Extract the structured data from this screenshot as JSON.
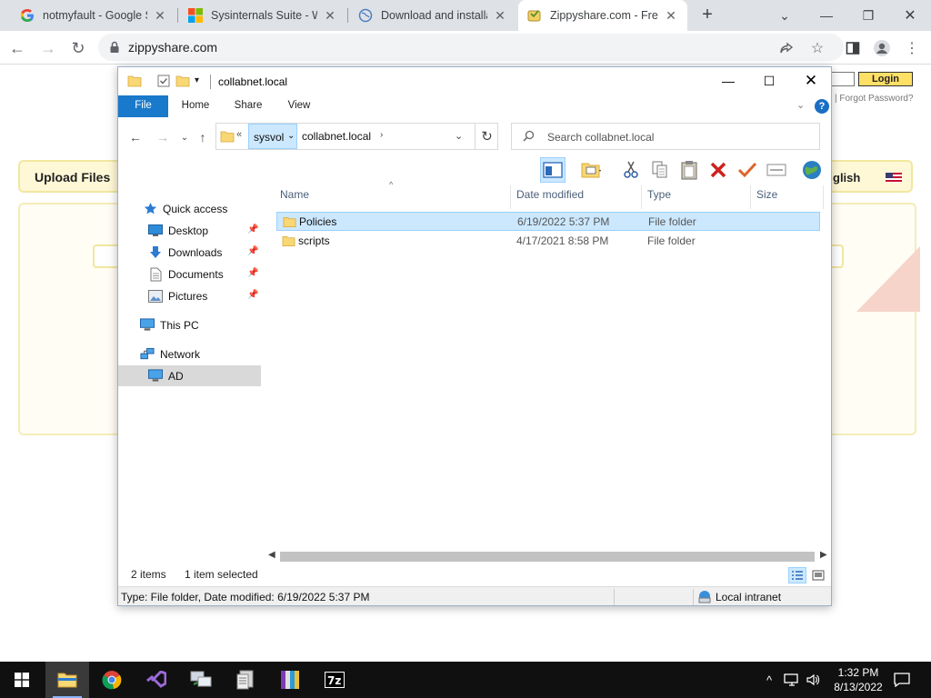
{
  "browser": {
    "tabs": [
      {
        "title": "notmyfault - Google Se",
        "icon": "google-g-icon"
      },
      {
        "title": "Sysinternals Suite - Wi",
        "icon": "microsoft-logo-icon"
      },
      {
        "title": "Download and installat",
        "icon": "globe-icon"
      },
      {
        "title": "Zippyshare.com - Free",
        "icon": "zippyshare-icon",
        "active": true
      }
    ],
    "url": "zippyshare.com"
  },
  "webpage": {
    "upload_tab": "Upload Files",
    "language_tab": "glish",
    "login_button": "Login",
    "forgot_password": "| Forgot Password?"
  },
  "explorer": {
    "title": "collabnet.local",
    "ribbon_tabs": [
      "File",
      "Home",
      "Share",
      "View"
    ],
    "breadcrumb": {
      "overflow": "«",
      "segments": [
        "sysvol",
        "collabnet.local"
      ]
    },
    "search_placeholder": "Search collabnet.local",
    "nav": {
      "quick_access": "Quick access",
      "desktop": "Desktop",
      "downloads": "Downloads",
      "documents": "Documents",
      "pictures": "Pictures",
      "this_pc": "This PC",
      "network": "Network",
      "ad": "AD"
    },
    "columns": {
      "name": "Name",
      "date": "Date modified",
      "type": "Type",
      "size": "Size"
    },
    "rows": [
      {
        "name": "Policies",
        "date": "6/19/2022 5:37 PM",
        "type": "File folder",
        "size": ""
      },
      {
        "name": "scripts",
        "date": "4/17/2021 8:58 PM",
        "type": "File folder",
        "size": ""
      }
    ],
    "status": {
      "items": "2 items",
      "selected": "1 item selected",
      "detail": "Type: File folder, Date modified: 6/19/2022 5:37 PM",
      "zone": "Local intranet"
    }
  },
  "taskbar": {
    "time": "1:32 PM",
    "date": "8/13/2022"
  },
  "colors": {
    "chrome_strip": "#dee1e6",
    "ribbon_file": "#1979ca",
    "selection": "#cce8ff",
    "folder": "#f8d775",
    "taskbar": "#101010"
  }
}
